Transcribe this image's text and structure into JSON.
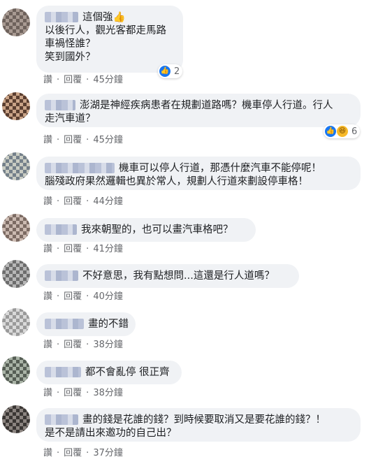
{
  "comments": [
    {
      "lines": [
        "這個強👍",
        "以後行人，觀光客都走馬路",
        "車禍怪誰？",
        "笑到國外？"
      ],
      "actions": {
        "like": "讚",
        "reply": "回覆",
        "time": "45分鐘"
      },
      "reaction": {
        "icons": [
          "like-icon"
        ],
        "count": "2"
      }
    },
    {
      "lines": [
        "澎湖是神經疾病患者在規劃道路嗎？機車停人行道。行人",
        "走汽車道？"
      ],
      "actions": {
        "like": "讚",
        "reply": "回覆",
        "time": "45分鐘"
      },
      "reaction": {
        "icons": [
          "haha-icon",
          "like-icon"
        ],
        "count": "6"
      }
    },
    {
      "lines": [
        "機車可以停人行道，那憑什麼汽車不能停呢！",
        "腦殘政府果然邏輯也異於常人，規劃人行道來劃設停車格！"
      ],
      "actions": {
        "like": "讚",
        "reply": "回覆",
        "time": "44分鐘"
      }
    },
    {
      "lines": [
        "我來朝聖的，也可以畫汽車格吧？"
      ],
      "actions": {
        "like": "讚",
        "reply": "回覆",
        "time": "41分鐘"
      }
    },
    {
      "lines": [
        "不好意思，我有點想問...這還是行人道嗎？"
      ],
      "actions": {
        "like": "讚",
        "reply": "回覆",
        "time": "40分鐘"
      }
    },
    {
      "lines": [
        "畫的不錯"
      ],
      "actions": {
        "like": "讚",
        "reply": "回覆",
        "time": "38分鐘"
      }
    },
    {
      "lines": [
        "都不會亂停 很正齊"
      ],
      "actions": {
        "like": "讚",
        "reply": "回覆",
        "time": "38分鐘"
      }
    },
    {
      "lines": [
        "畫的錢是花誰的錢？到時候要取消又是要花誰的錢？！",
        "是不是請出來邀功的自己出？"
      ],
      "actions": {
        "like": "讚",
        "reply": "回覆",
        "time": "37分鐘"
      }
    }
  ],
  "colors": {
    "bubble": "#f0f2f5",
    "action_text": "#65676b",
    "like_blue": "#1877f2",
    "haha_yellow": "#f7b928"
  }
}
